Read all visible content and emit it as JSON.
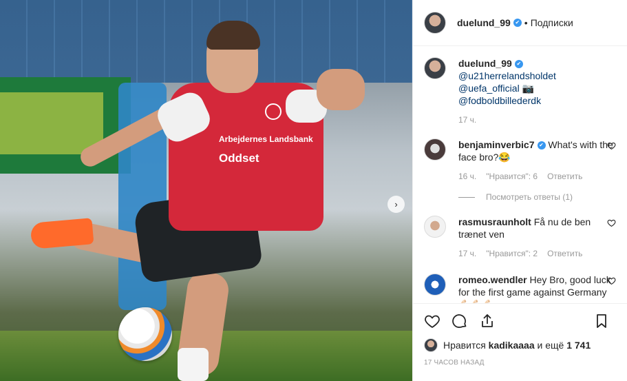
{
  "post": {
    "username": "duelund_99",
    "verified_badge": "✔",
    "follow_label": "Подписки",
    "dot": "•",
    "next_arrow": "›",
    "jersey_text_1": "Arbejdernes Landsbank",
    "jersey_text_2": "Oddset"
  },
  "caption": {
    "username": "duelund_99",
    "mention1": "@u21herrelandsholdet",
    "mention2": "@uefa_official",
    "camera_emoji": "📷",
    "mention3": "@fodboldbillederdk",
    "time": "17 ч."
  },
  "comments": [
    {
      "username": "benjaminverbic7",
      "text": "What's with the face bro?😂",
      "time": "16 ч.",
      "likes": "\"Нравится\": 6",
      "reply": "Ответить",
      "view_replies": "Посмотреть ответы (1)"
    },
    {
      "username": "rasmusraunholt",
      "text": "Få nu de ben trænet ven",
      "time": "17 ч.",
      "likes": "\"Нравится\": 2",
      "reply": "Ответить"
    },
    {
      "username": "romeo.wendler",
      "text": "Hey Bro, good luck for the first game against Germany 💪🏻💪🏻💪🏻"
    }
  ],
  "actions": {
    "likes_prefix": "Нравится",
    "likes_user": "kadikaaaa",
    "likes_suffix": "и ещё",
    "likes_count": "1 741",
    "timestamp": "17 ЧАСОВ НАЗАД"
  },
  "icons": [
    "heart-icon",
    "comment-icon",
    "share-icon",
    "bookmark-icon",
    "next-arrow-icon",
    "verified-icon"
  ],
  "colors": {
    "link": "#003569",
    "verified": "#3897f0",
    "muted": "#999999",
    "border": "#efefef"
  }
}
